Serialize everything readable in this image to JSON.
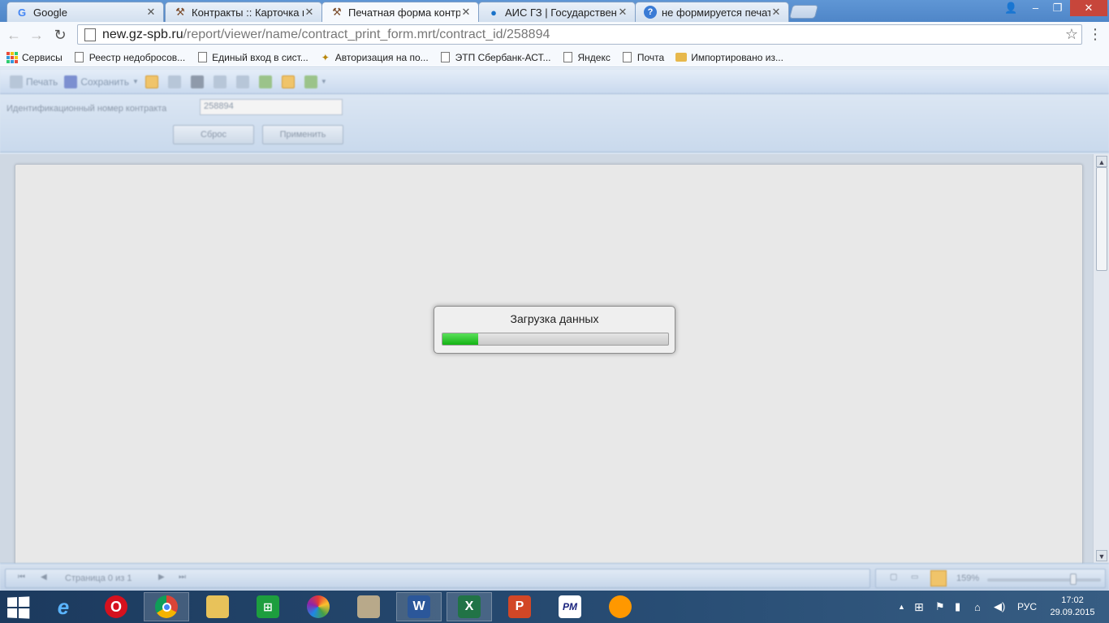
{
  "browser": {
    "tabs": [
      {
        "title": "Google",
        "icon": "google-icon",
        "active": false
      },
      {
        "title": "Контракты :: Карточка ко",
        "icon": "tools-icon",
        "active": false
      },
      {
        "title": "Печатная форма контра",
        "icon": "tools-icon",
        "active": true
      },
      {
        "title": "АИС ГЗ | Государственны",
        "icon": "globe-icon",
        "active": false
      },
      {
        "title": "не формируется печатна",
        "icon": "help-icon",
        "active": false
      }
    ],
    "url_host": "new.gz-spb.ru",
    "url_path": "/report/viewer/name/contract_print_form.mrt/contract_id/258894",
    "bookmarks": [
      {
        "label": "Сервисы",
        "icon": "apps-icon"
      },
      {
        "label": "Реестр недобросов...",
        "icon": "page-icon"
      },
      {
        "label": "Единый вход в сист...",
        "icon": "page-icon"
      },
      {
        "label": "Авторизация на по...",
        "icon": "emblem-icon"
      },
      {
        "label": "ЭТП Сбербанк-АСТ...",
        "icon": "page-icon"
      },
      {
        "label": "Яндекс",
        "icon": "page-icon"
      },
      {
        "label": "Почта",
        "icon": "page-icon"
      },
      {
        "label": "Импортировано из...",
        "icon": "folder-icon"
      }
    ]
  },
  "viewer": {
    "toolbar": {
      "print_label": "Печать",
      "save_label": "Сохранить"
    },
    "params": {
      "contract_id_label": "Идентификационный номер контракта",
      "contract_id_value": "258894",
      "reset_label": "Сброс",
      "apply_label": "Применить"
    },
    "loading": {
      "text": "Загрузка данных",
      "progress": 0.16
    },
    "status": {
      "page_text": "Страница 0 из 1",
      "zoom": "159%"
    }
  },
  "taskbar": {
    "apps": [
      "internet-explorer-icon",
      "opera-icon",
      "chrome-icon",
      "file-explorer-icon",
      "store-icon",
      "picasa-icon",
      "utility-icon",
      "word-icon",
      "excel-icon",
      "powerpoint-icon",
      "pm-icon",
      "sun-app-icon"
    ],
    "language": "РУС",
    "time": "17:02",
    "date": "29.09.2015"
  }
}
